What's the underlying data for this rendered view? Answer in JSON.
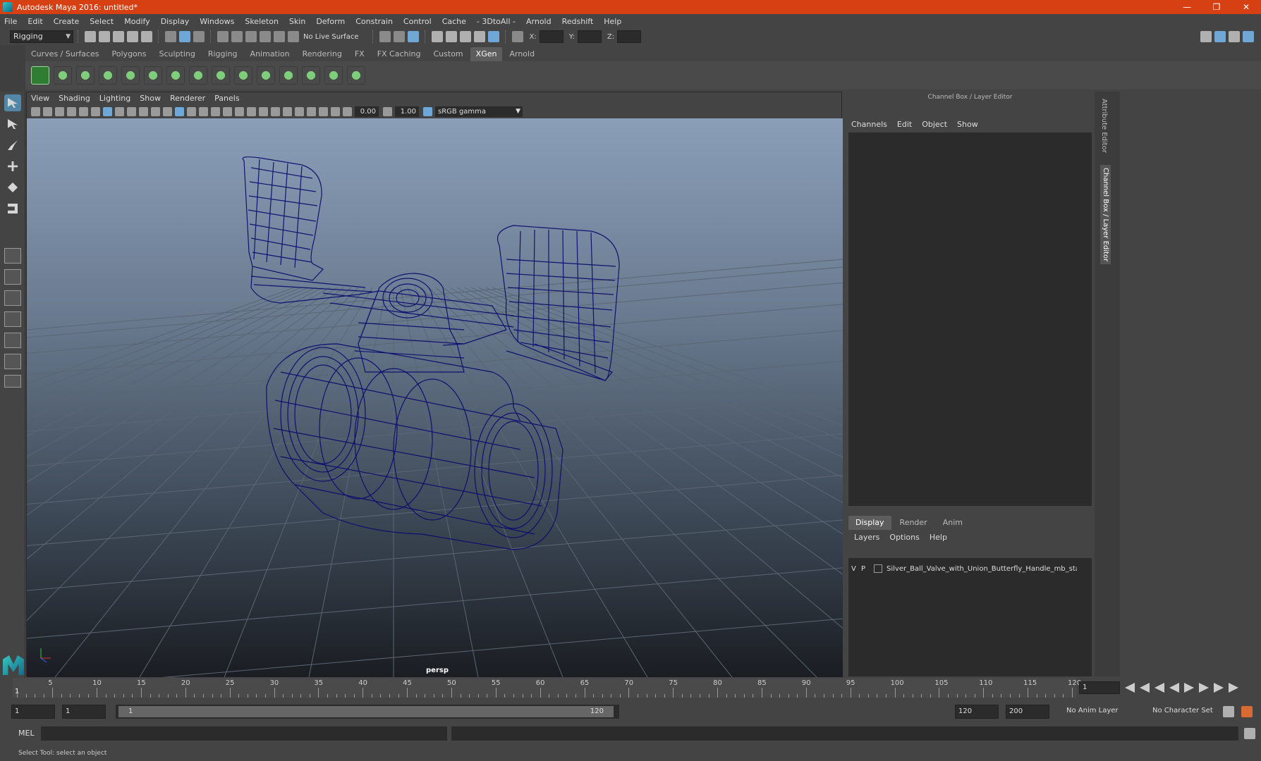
{
  "window": {
    "title": "Autodesk Maya 2016: untitled*",
    "controls": [
      "—",
      "❐",
      "✕"
    ]
  },
  "menubar": [
    "File",
    "Edit",
    "Create",
    "Select",
    "Modify",
    "Display",
    "Windows",
    "Skeleton",
    "Skin",
    "Deform",
    "Constrain",
    "Control",
    "Cache",
    "- 3DtoAll -",
    "Arnold",
    "Redshift",
    "Help"
  ],
  "statusline": {
    "menuset": "Rigging",
    "live_surface": "No Live Surface",
    "x_label": "X:",
    "y_label": "Y:",
    "z_label": "Z:"
  },
  "shelf": {
    "tabs": [
      "Curves / Surfaces",
      "Polygons",
      "Sculpting",
      "Rigging",
      "Animation",
      "Rendering",
      "FX",
      "FX Caching",
      "Custom",
      "XGen",
      "Arnold"
    ],
    "active_tab": "XGen"
  },
  "viewport": {
    "menu": [
      "View",
      "Shading",
      "Lighting",
      "Show",
      "Renderer",
      "Panels"
    ],
    "exposure": "0.00",
    "gamma_value": "1.00",
    "color_space": "sRGB gamma",
    "camera": "persp"
  },
  "channel_box": {
    "title": "Channel Box / Layer Editor",
    "menu": [
      "Channels",
      "Edit",
      "Object",
      "Show"
    ]
  },
  "layer_editor": {
    "tabs": [
      "Display",
      "Render",
      "Anim"
    ],
    "active_tab": "Display",
    "menu": [
      "Layers",
      "Options",
      "Help"
    ],
    "layers": [
      {
        "vis": "V",
        "playback": "P",
        "name": "Silver_Ball_Valve_with_Union_Butterfly_Handle_mb_standart"
      }
    ]
  },
  "side_tabs": [
    "Attribute Editor",
    "Channel Box / Layer Editor"
  ],
  "time_slider": {
    "start": 1,
    "end": 120,
    "labels": [
      "5",
      "10",
      "15",
      "20",
      "25",
      "30",
      "35",
      "40",
      "45",
      "50",
      "55",
      "60",
      "65",
      "70",
      "75",
      "80",
      "85",
      "90",
      "95",
      "100",
      "105",
      "110",
      "115",
      "120"
    ],
    "current_frame": "1",
    "current_marker": "1"
  },
  "range_slider": {
    "start_time": "1",
    "playback_start": "1",
    "range_start_label": "1",
    "range_end_label": "120",
    "playback_end": "120",
    "end_time": "200",
    "anim_layer": "No Anim Layer",
    "character_set": "No Character Set"
  },
  "command_line": {
    "language": "MEL"
  },
  "help_line": "Select Tool: select an object"
}
